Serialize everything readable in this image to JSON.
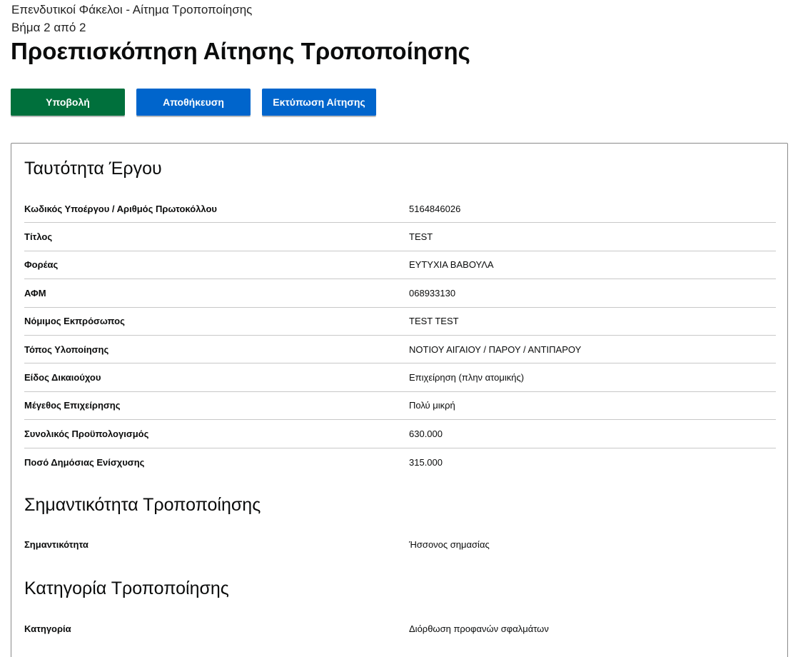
{
  "header": {
    "breadcrumb": "Επενδυτικοί Φάκελοι - Αίτημα Τροποποίησης",
    "step": "Βήμα 2 από 2",
    "title": "Προεπισκόπηση Αίτησης Τροποποίησης"
  },
  "actions": {
    "submit_label": "Υποβολή",
    "save_label": "Αποθήκευση",
    "print_label": "Εκτύπωση Αίτησης"
  },
  "colors": {
    "submit": "#00703c",
    "primary": "#0065cc"
  },
  "project_identity": {
    "title": "Ταυτότητα Έργου",
    "rows": [
      {
        "key": "Κωδικός Υποέργου / Αριθμός Πρωτοκόλλου",
        "value": "5164846026"
      },
      {
        "key": "Τίτλος",
        "value": "TEST"
      },
      {
        "key": "Φορέας",
        "value": "ΕΥΤΥΧΙΑ ΒΑΒΟΥΛΑ"
      },
      {
        "key": "ΑΦΜ",
        "value": "068933130"
      },
      {
        "key": "Νόμιμος Εκπρόσωπος",
        "value": "TEST TEST"
      },
      {
        "key": "Τόπος Υλοποίησης",
        "value": "ΝΟΤΙΟΥ ΑΙΓΑΙΟΥ / ΠΑΡΟΥ / ΑΝΤΙΠΑΡΟΥ"
      },
      {
        "key": "Είδος Δικαιούχου",
        "value": "Επιχείρηση (πλην ατομικής)"
      },
      {
        "key": "Μέγεθος Επιχείρησης",
        "value": "Πολύ μικρή"
      },
      {
        "key": "Συνολικός Προϋπολογισμός",
        "value": "630.000"
      },
      {
        "key": "Ποσό Δημόσιας Ενίσχυσης",
        "value": "315.000"
      }
    ]
  },
  "significance": {
    "title": "Σημαντικότητα Τροποποίησης",
    "rows": [
      {
        "key": "Σημαντικότητα",
        "value": "Ήσσονος σημασίας"
      }
    ]
  },
  "category": {
    "title": "Κατηγορία Τροποποίησης",
    "rows": [
      {
        "key": "Κατηγορία",
        "value": "Διόρθωση προφανών σφαλμάτων"
      }
    ]
  }
}
